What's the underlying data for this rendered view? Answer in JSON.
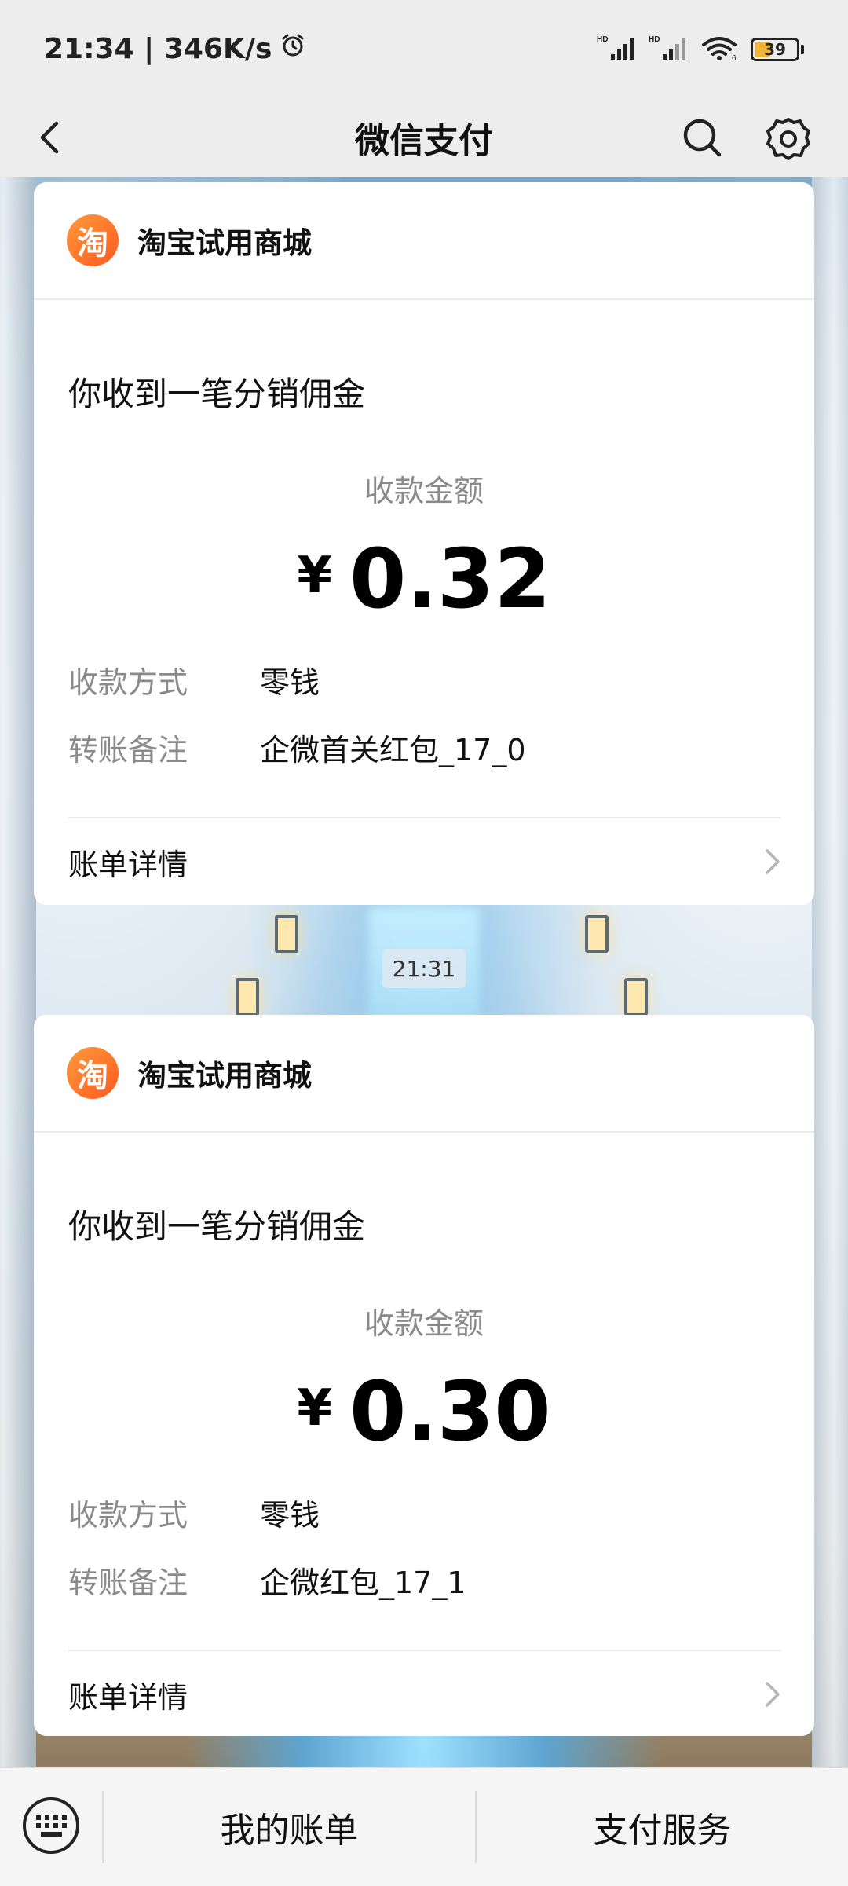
{
  "status_bar": {
    "time_speed": "21:34 | 346K/s",
    "battery_level": "39",
    "battery_percent": 39
  },
  "nav": {
    "title": "微信支付"
  },
  "messages": [
    {
      "merchant_logo_char": "淘",
      "merchant_name": "淘宝试用商城",
      "headline": "你收到一笔分销佣金",
      "amount_label": "收款金额",
      "currency_symbol": "¥",
      "amount": "0.32",
      "method_label": "收款方式",
      "method_value": "零钱",
      "note_label": "转账备注",
      "note_value": "企微首关红包_17_0",
      "bill_link_label": "账单详情"
    },
    {
      "merchant_logo_char": "淘",
      "merchant_name": "淘宝试用商城",
      "headline": "你收到一笔分销佣金",
      "amount_label": "收款金额",
      "currency_symbol": "¥",
      "amount": "0.30",
      "method_label": "收款方式",
      "method_value": "零钱",
      "note_label": "转账备注",
      "note_value": "企微红包_17_1",
      "bill_link_label": "账单详情"
    }
  ],
  "timestamp_chip": "21:31",
  "bottom_bar": {
    "item_1": "我的账单",
    "item_2": "支付服务"
  },
  "icons": {
    "back": "chevron-left-icon",
    "search": "search-icon",
    "settings": "gear-icon",
    "keyboard": "keyboard-icon",
    "chevron": "chevron-right-icon",
    "alarm": "alarm-clock-icon",
    "signal": "signal-icon",
    "wifi": "wifi-icon",
    "battery": "battery-icon"
  },
  "colors": {
    "background": "#ededed",
    "card": "#ffffff",
    "muted_text": "#8a8a8a",
    "logo_orange": "#ff6a21",
    "battery_fill": "#f0b33a"
  }
}
